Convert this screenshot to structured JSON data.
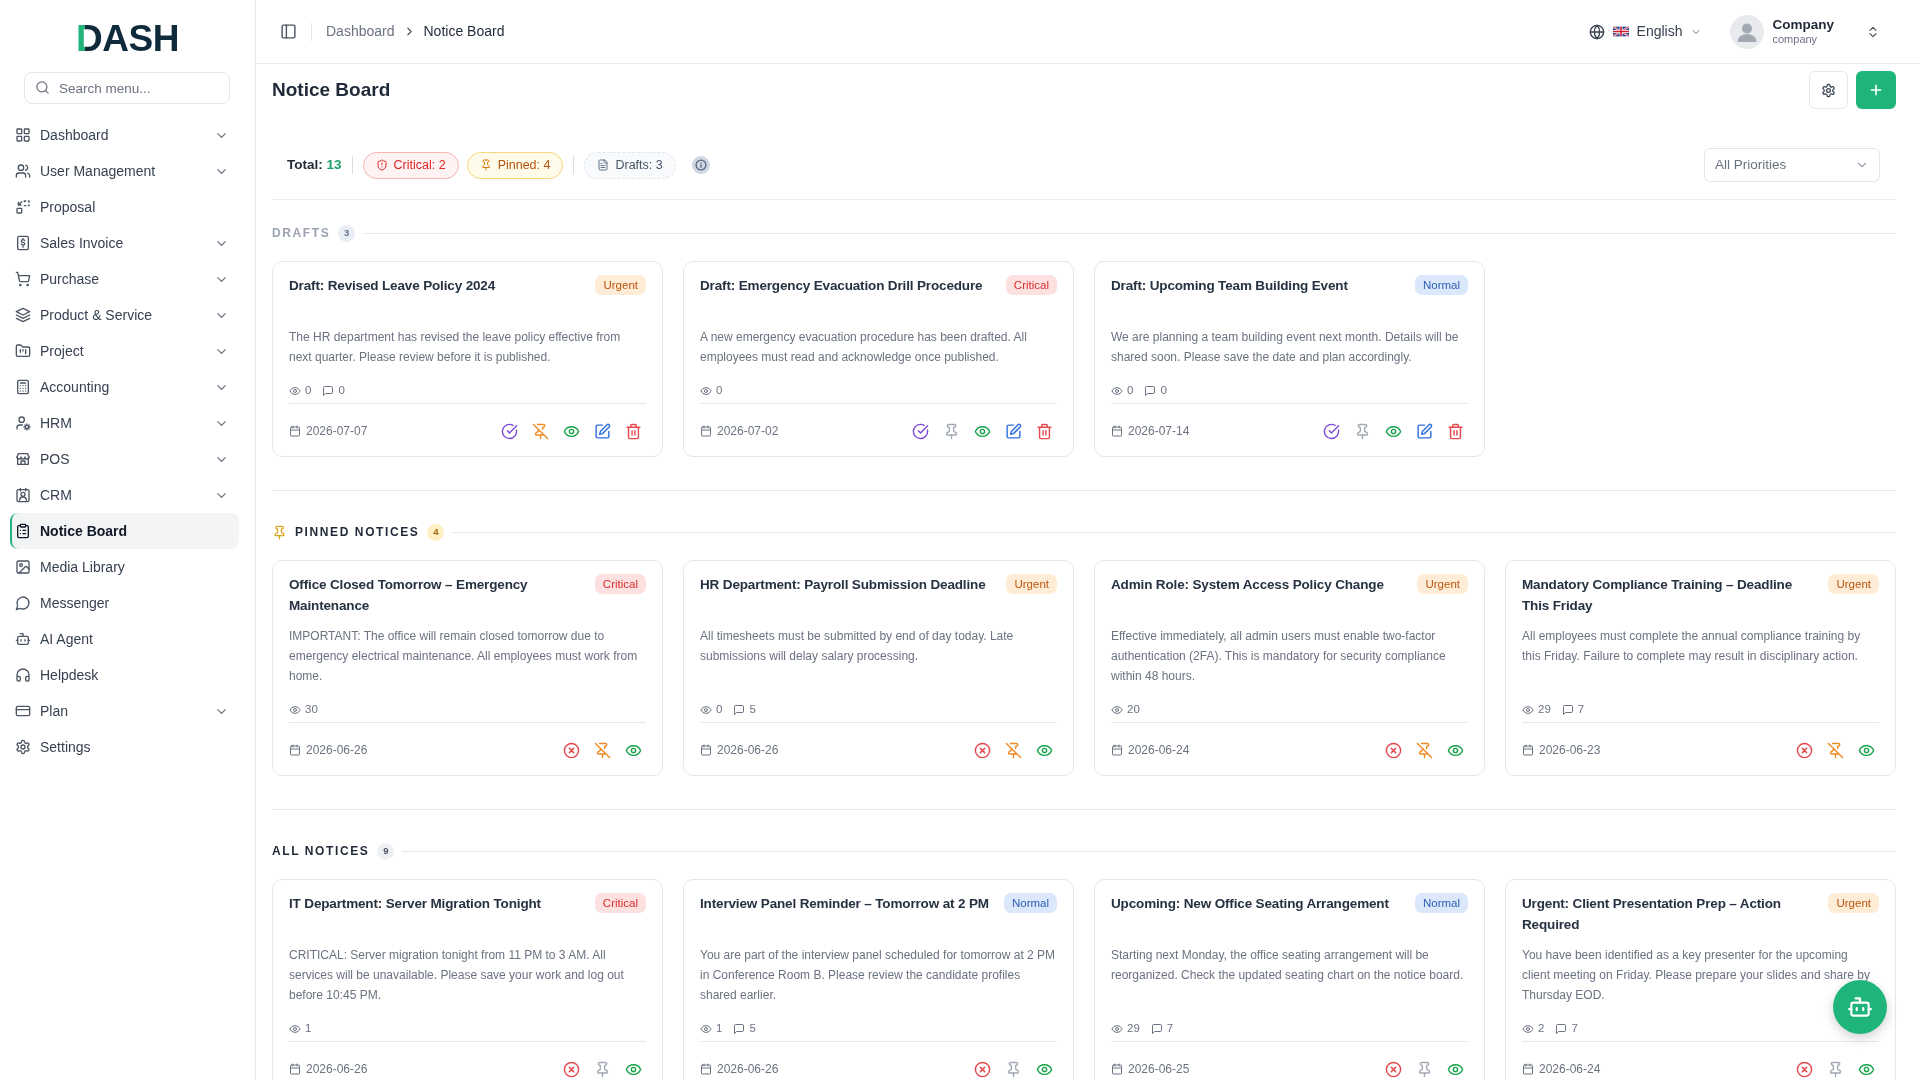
{
  "sidebar": {
    "logo": "DASH",
    "search": {
      "placeholder": "Search menu..."
    },
    "items": [
      {
        "label": "Dashboard",
        "submenu": true,
        "selected": false
      },
      {
        "label": "User Management",
        "submenu": true,
        "selected": false
      },
      {
        "label": "Proposal",
        "submenu": false,
        "selected": false
      },
      {
        "label": "Sales Invoice",
        "submenu": true,
        "selected": false
      },
      {
        "label": "Purchase",
        "submenu": true,
        "selected": false
      },
      {
        "label": "Product & Service",
        "submenu": true,
        "selected": false
      },
      {
        "label": "Project",
        "submenu": true,
        "selected": false
      },
      {
        "label": "Accounting",
        "submenu": true,
        "selected": false
      },
      {
        "label": "HRM",
        "submenu": true,
        "selected": false
      },
      {
        "label": "POS",
        "submenu": true,
        "selected": false
      },
      {
        "label": "CRM",
        "submenu": true,
        "selected": false
      },
      {
        "label": "Notice Board",
        "submenu": false,
        "selected": true
      },
      {
        "label": "Media Library",
        "submenu": false,
        "selected": false
      },
      {
        "label": "Messenger",
        "submenu": false,
        "selected": false
      },
      {
        "label": "AI Agent",
        "submenu": false,
        "selected": false
      },
      {
        "label": "Helpdesk",
        "submenu": false,
        "selected": false
      },
      {
        "label": "Plan",
        "submenu": true,
        "selected": false
      },
      {
        "label": "Settings",
        "submenu": false,
        "selected": false
      }
    ]
  },
  "header": {
    "breadcrumb": [
      {
        "label": "Dashboard",
        "current": false
      },
      {
        "label": "Notice Board",
        "current": true
      }
    ],
    "language": "English",
    "user": {
      "name": "Company",
      "role": "company"
    }
  },
  "page": {
    "title": "Notice Board"
  },
  "summary": {
    "total_label": "Total:",
    "total": "13",
    "chips": [
      {
        "kind": "critical",
        "label": "Critical: 2"
      },
      {
        "kind": "pinned",
        "label": "Pinned: 4"
      },
      {
        "kind": "drafts",
        "label": "Drafts: 3"
      }
    ],
    "filter": {
      "value": "All Priorities"
    }
  },
  "sections": [
    {
      "kind": "drafts",
      "title": "DRAFTS",
      "count": "3",
      "notices": [
        {
          "title": "Draft: Revised Leave Policy 2024",
          "badge": {
            "text": "Urgent",
            "kind": "urgent"
          },
          "body": "The HR department has revised the leave policy effective from next quarter. Please review before it is published.",
          "views": "0",
          "comments": "0",
          "date": "2026-07-07",
          "pinned": true
        },
        {
          "title": "Draft: Emergency Evacuation Drill Procedure",
          "badge": {
            "text": "Critical",
            "kind": "critical"
          },
          "body": "A new emergency evacuation procedure has been drafted. All employees must read and acknowledge once published.",
          "views": "0",
          "date": "2026-07-02",
          "pinned": false
        },
        {
          "title": "Draft: Upcoming Team Building Event",
          "badge": {
            "text": "Normal",
            "kind": "normal"
          },
          "body": "We are planning a team building event next month. Details will be shared soon. Please save the date and plan accordingly.",
          "views": "0",
          "comments": "0",
          "date": "2026-07-14",
          "pinned": false
        }
      ]
    },
    {
      "kind": "pinned",
      "title": "PINNED NOTICES",
      "count": "4",
      "notices": [
        {
          "title": "Office Closed Tomorrow – Emergency Maintenance",
          "badge": {
            "text": "Critical",
            "kind": "critical"
          },
          "body": "IMPORTANT: The office will remain closed tomorrow due to emergency electrical maintenance. All employees must work from home.",
          "views": "30",
          "date": "2026-06-26",
          "pinned": true
        },
        {
          "title": "HR Department: Payroll Submission Deadline",
          "badge": {
            "text": "Urgent",
            "kind": "urgent"
          },
          "body": "All timesheets must be submitted by end of day today. Late submissions will delay salary processing.",
          "views": "0",
          "comments": "5",
          "date": "2026-06-26",
          "pinned": true
        },
        {
          "title": "Admin Role: System Access Policy Change",
          "badge": {
            "text": "Urgent",
            "kind": "urgent"
          },
          "body": "Effective immediately, all admin users must enable two-factor authentication (2FA). This is mandatory for security compliance within 48 hours.",
          "views": "20",
          "date": "2026-06-24",
          "pinned": true
        },
        {
          "title": "Mandatory Compliance Training – Deadline This Friday",
          "badge": {
            "text": "Urgent",
            "kind": "urgent"
          },
          "body": "All employees must complete the annual compliance training by this Friday. Failure to complete may result in disciplinary action.",
          "views": "29",
          "comments": "7",
          "date": "2026-06-23",
          "pinned": true
        }
      ]
    },
    {
      "kind": "all",
      "title": "ALL NOTICES",
      "count": "9",
      "notices": [
        {
          "title": "IT Department: Server Migration Tonight",
          "badge": {
            "text": "Critical",
            "kind": "critical"
          },
          "body": "CRITICAL: Server migration tonight from 11 PM to 3 AM. All services will be unavailable. Please save your work and log out before 10:45 PM.",
          "views": "1",
          "date": "2026-06-26",
          "pinned": false
        },
        {
          "title": "Interview Panel Reminder – Tomorrow at 2 PM",
          "badge": {
            "text": "Normal",
            "kind": "normal"
          },
          "body": "You are part of the interview panel scheduled for tomorrow at 2 PM in Conference Room B. Please review the candidate profiles shared earlier.",
          "views": "1",
          "comments": "5",
          "date": "2026-06-26",
          "pinned": false
        },
        {
          "title": "Upcoming: New Office Seating Arrangement",
          "badge": {
            "text": "Normal",
            "kind": "normal"
          },
          "body": "Starting next Monday, the office seating arrangement will be reorganized. Check the updated seating chart on the notice board.",
          "views": "29",
          "comments": "7",
          "date": "2026-06-25",
          "pinned": false
        },
        {
          "title": "Urgent: Client Presentation Prep – Action Required",
          "badge": {
            "text": "Urgent",
            "kind": "urgent"
          },
          "body": "You have been identified as a key presenter for the upcoming client meeting on Friday. Please prepare your slides and share by Thursday EOD.",
          "views": "2",
          "comments": "7",
          "date": "2026-06-24",
          "pinned": false
        }
      ]
    }
  ]
}
